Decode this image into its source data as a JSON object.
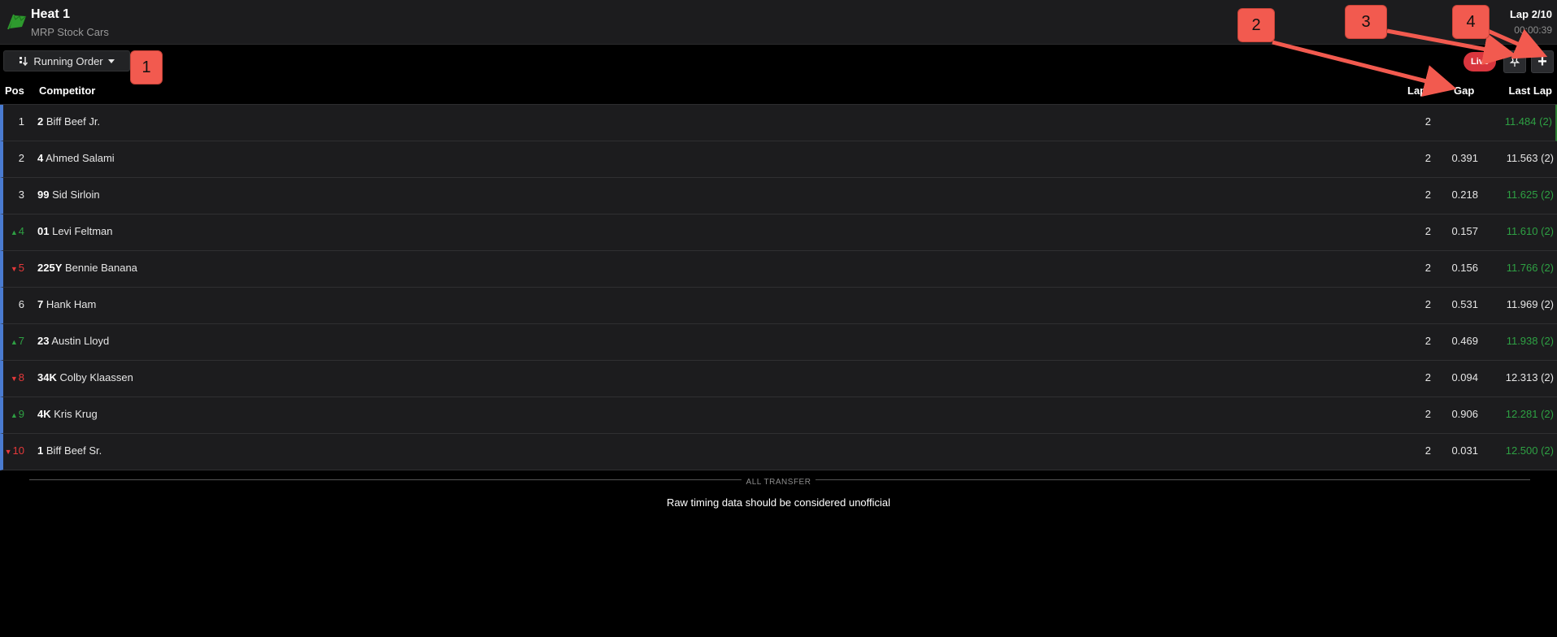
{
  "header": {
    "title": "Heat 1",
    "subtitle": "MRP Stock Cars",
    "lap": "Lap 2/10",
    "time": "00:00:39",
    "flag_color": "#2e9a2e"
  },
  "toolbar": {
    "view_label": "Running Order",
    "live_label": "Live",
    "pin_icon": "pin-icon",
    "plus_label": "+"
  },
  "columns": {
    "pos": "Pos",
    "competitor": "Competitor",
    "lap": "Lap",
    "gap": "Gap",
    "last_lap": "Last Lap"
  },
  "rows": [
    {
      "pos": "1",
      "change": "",
      "number": "2",
      "name": "Biff Beef Jr.",
      "lap": "2",
      "gap": "",
      "last": "11.484 (2)",
      "best": true
    },
    {
      "pos": "2",
      "change": "",
      "number": "4",
      "name": "Ahmed Salami",
      "lap": "2",
      "gap": "0.391",
      "last": "11.563 (2)",
      "best": false
    },
    {
      "pos": "3",
      "change": "",
      "number": "99",
      "name": "Sid Sirloin",
      "lap": "2",
      "gap": "0.218",
      "last": "11.625 (2)",
      "best": true
    },
    {
      "pos": "4",
      "change": "up",
      "number": "01",
      "name": "Levi Feltman",
      "lap": "2",
      "gap": "0.157",
      "last": "11.610 (2)",
      "best": true
    },
    {
      "pos": "5",
      "change": "down",
      "number": "225Y",
      "name": "Bennie Banana",
      "lap": "2",
      "gap": "0.156",
      "last": "11.766 (2)",
      "best": true
    },
    {
      "pos": "6",
      "change": "",
      "number": "7",
      "name": "Hank Ham",
      "lap": "2",
      "gap": "0.531",
      "last": "11.969 (2)",
      "best": false
    },
    {
      "pos": "7",
      "change": "up",
      "number": "23",
      "name": "Austin Lloyd",
      "lap": "2",
      "gap": "0.469",
      "last": "11.938 (2)",
      "best": true
    },
    {
      "pos": "8",
      "change": "down",
      "number": "34K",
      "name": "Colby Klaassen",
      "lap": "2",
      "gap": "0.094",
      "last": "12.313 (2)",
      "best": false
    },
    {
      "pos": "9",
      "change": "up",
      "number": "4K",
      "name": "Kris Krug",
      "lap": "2",
      "gap": "0.906",
      "last": "12.281 (2)",
      "best": true
    },
    {
      "pos": "10",
      "change": "down",
      "number": "1",
      "name": "Biff Beef Sr.",
      "lap": "2",
      "gap": "0.031",
      "last": "12.500 (2)",
      "best": true
    }
  ],
  "footer": {
    "divider_label": "ALL TRANSFER",
    "disclaimer": "Raw timing data should be considered unofficial"
  },
  "callouts": [
    "1",
    "2",
    "3",
    "4"
  ]
}
